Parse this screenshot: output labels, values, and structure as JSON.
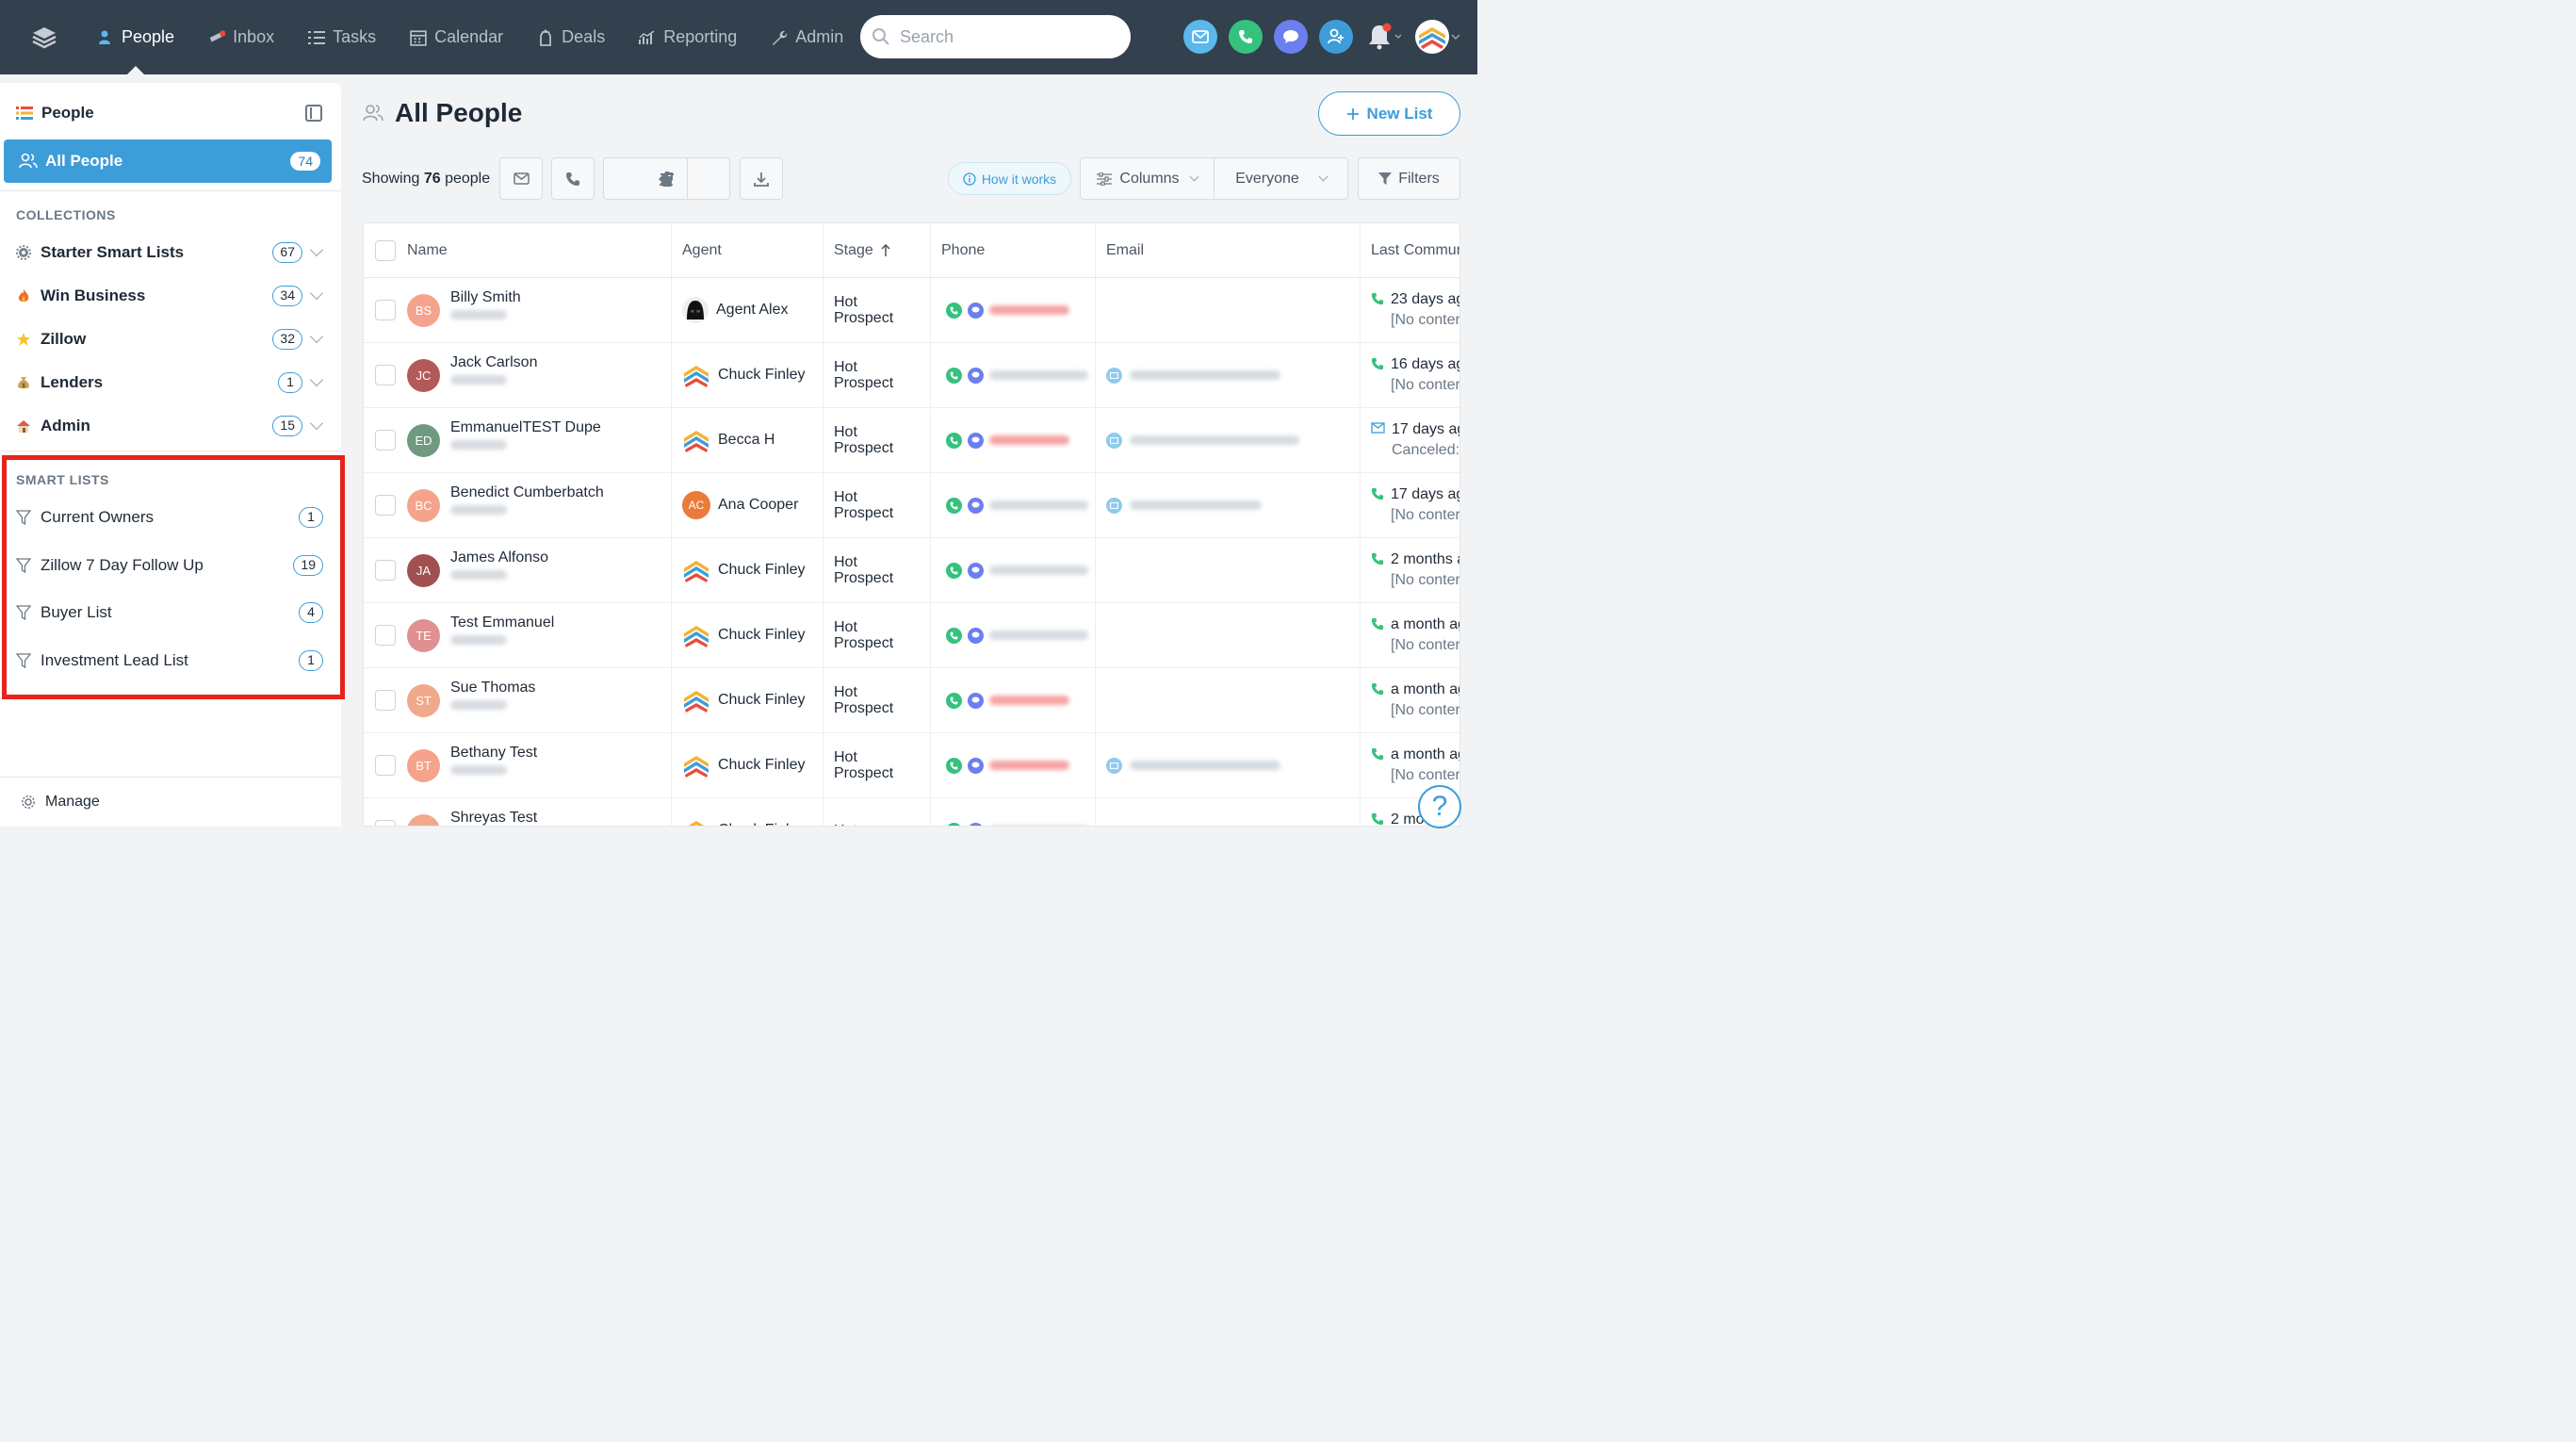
{
  "topnav": {
    "items": [
      {
        "label": "People",
        "icon": "people-icon",
        "active": true
      },
      {
        "label": "Inbox",
        "icon": "inbox-icon",
        "active": false
      },
      {
        "label": "Tasks",
        "icon": "tasks-icon",
        "active": false
      },
      {
        "label": "Calendar",
        "icon": "calendar-icon",
        "active": false
      },
      {
        "label": "Deals",
        "icon": "deals-icon",
        "active": false
      },
      {
        "label": "Reporting",
        "icon": "reporting-icon",
        "active": false
      },
      {
        "label": "Admin",
        "icon": "wrench-icon",
        "active": false
      }
    ],
    "search_placeholder": "Search",
    "quick_actions": [
      "email-icon",
      "phone-icon",
      "chat-icon",
      "add-person-icon"
    ]
  },
  "sidebar": {
    "title": "People",
    "all_people": {
      "label": "All People",
      "count": "74"
    },
    "collections_title": "COLLECTIONS",
    "collections": [
      {
        "label": "Starter Smart Lists",
        "count": "67",
        "icon": "gear-icon"
      },
      {
        "label": "Win Business",
        "count": "34",
        "icon": "fire-icon"
      },
      {
        "label": "Zillow",
        "count": "32",
        "icon": "star-icon"
      },
      {
        "label": "Lenders",
        "count": "1",
        "icon": "money-bag-icon"
      },
      {
        "label": "Admin",
        "count": "15",
        "icon": "house-icon"
      }
    ],
    "smart_lists_title": "SMART LISTS",
    "smart_lists": [
      {
        "label": "Current Owners",
        "count": "1"
      },
      {
        "label": "Zillow 7 Day Follow Up",
        "count": "19"
      },
      {
        "label": "Buyer List",
        "count": "4"
      },
      {
        "label": "Investment Lead List",
        "count": "1"
      }
    ],
    "manage_label": "Manage"
  },
  "main": {
    "title": "All People",
    "new_list_label": "New List",
    "showing_prefix": "Showing",
    "showing_count": "76",
    "showing_suffix": "people",
    "how_it_works": "How it works",
    "columns_label": "Columns",
    "everyone_label": "Everyone",
    "filters_label": "Filters"
  },
  "table": {
    "headers": {
      "name": "Name",
      "agent": "Agent",
      "stage": "Stage",
      "phone": "Phone",
      "email": "Email",
      "last": "Last Commun"
    },
    "rows": [
      {
        "initials": "BS",
        "color": "#f5a38c",
        "name": "Billy Smith",
        "agent": "Agent Alex",
        "agent_icon": "vader",
        "stage1": "Hot",
        "stage2": "Prospect",
        "phone_red": true,
        "email": false,
        "last1": "23 days ag",
        "last2": "[No conter",
        "last_icon": "phone"
      },
      {
        "initials": "JC",
        "color": "#b35a58",
        "name": "Jack Carlson",
        "agent": "Chuck Finley",
        "agent_icon": "logo",
        "stage1": "Hot",
        "stage2": "Prospect",
        "phone_red": false,
        "email": true,
        "last1": "16 days ag",
        "last2": "[No conter",
        "last_icon": "phone"
      },
      {
        "initials": "ED",
        "color": "#6f9a7e",
        "name": "EmmanuelTEST Dupe",
        "agent": "Becca H",
        "agent_icon": "logo",
        "stage1": "Hot",
        "stage2": "Prospect",
        "phone_red": true,
        "email": true,
        "last1": "17 days ag",
        "last2": "Canceled:",
        "last_icon": "mail"
      },
      {
        "initials": "BC",
        "color": "#f5a38c",
        "name": "Benedict Cumberbatch",
        "agent": "Ana Cooper",
        "agent_icon": "ac",
        "stage1": "Hot",
        "stage2": "Prospect",
        "phone_red": false,
        "email": true,
        "last1": "17 days ag",
        "last2": "[No conter",
        "last_icon": "phone"
      },
      {
        "initials": "JA",
        "color": "#a2504f",
        "name": "James Alfonso",
        "agent": "Chuck Finley",
        "agent_icon": "logo",
        "stage1": "Hot",
        "stage2": "Prospect",
        "phone_red": false,
        "email": false,
        "last1": "2 months a",
        "last2": "[No conter",
        "last_icon": "phone"
      },
      {
        "initials": "TE",
        "color": "#e09090",
        "name": "Test Emmanuel",
        "agent": "Chuck Finley",
        "agent_icon": "logo",
        "stage1": "Hot",
        "stage2": "Prospect",
        "phone_red": false,
        "email": false,
        "last1": "a month ag",
        "last2": "[No conter",
        "last_icon": "phone"
      },
      {
        "initials": "ST",
        "color": "#f0a98a",
        "name": "Sue Thomas",
        "agent": "Chuck Finley",
        "agent_icon": "logo",
        "stage1": "Hot",
        "stage2": "Prospect",
        "phone_red": true,
        "email": false,
        "last1": "a month ag",
        "last2": "[No conter",
        "last_icon": "phone"
      },
      {
        "initials": "BT",
        "color": "#f5a38c",
        "name": "Bethany Test",
        "agent": "Chuck Finley",
        "agent_icon": "logo",
        "stage1": "Hot",
        "stage2": "Prospect",
        "phone_red": true,
        "email": true,
        "last1": "a month ag",
        "last2": "[No conter",
        "last_icon": "phone"
      },
      {
        "initials": "ST",
        "color": "#f0a98a",
        "name": "Shreyas Test",
        "agent": "Chuck Finley",
        "agent_icon": "logo",
        "stage1": "Hot",
        "stage2": "",
        "phone_red": false,
        "email": false,
        "last1": "2 mo",
        "last2": "",
        "last_icon": "phone"
      }
    ]
  },
  "colors": {
    "accent": "#3d9dd9",
    "topnav": "#33404d",
    "highlight_box": "#e8231a"
  }
}
